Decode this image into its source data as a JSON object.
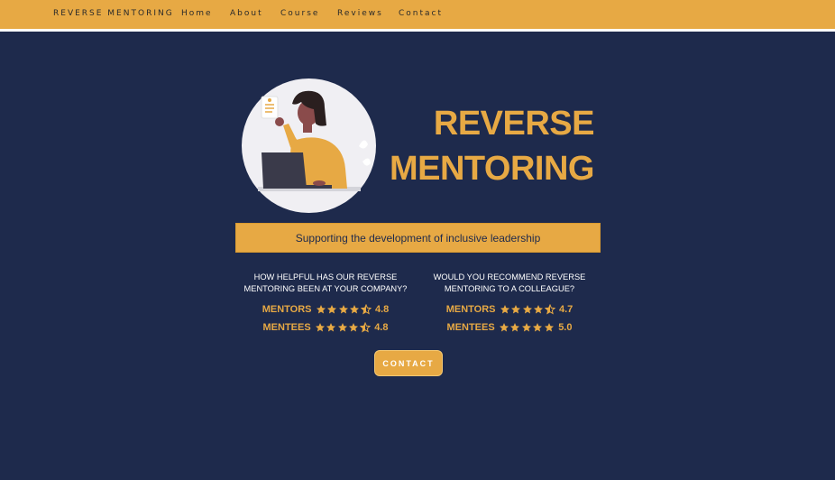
{
  "nav": {
    "brand": "REVERSE MENTORING",
    "items": [
      "Home",
      "About",
      "Course",
      "Reviews",
      "Contact"
    ]
  },
  "hero": {
    "title_line1": "REVERSE",
    "title_line2": "MENTORING",
    "tagline": "Supporting the development of inclusive leadership"
  },
  "ratings": {
    "left": {
      "question": "HOW HELPFUL HAS OUR REVERSE MENTORING BEEN AT YOUR COMPANY?",
      "rows": [
        {
          "label": "MENTORS",
          "score": "4.8",
          "stars": 4.5
        },
        {
          "label": "MENTEES",
          "score": "4.8",
          "stars": 4.5
        }
      ]
    },
    "right": {
      "question": "WOULD YOU RECOMMEND REVERSE MENTORING TO A COLLEAGUE?",
      "rows": [
        {
          "label": "MENTORS",
          "score": "4.7",
          "stars": 4.5
        },
        {
          "label": "MENTEES",
          "score": "5.0",
          "stars": 5
        }
      ]
    }
  },
  "cta": {
    "label": "CONTACT"
  },
  "colors": {
    "accent": "#e7a944",
    "background": "#1e2a4c",
    "text_light": "#ffffff"
  },
  "icons": [
    "star-icon",
    "star-half-icon"
  ]
}
